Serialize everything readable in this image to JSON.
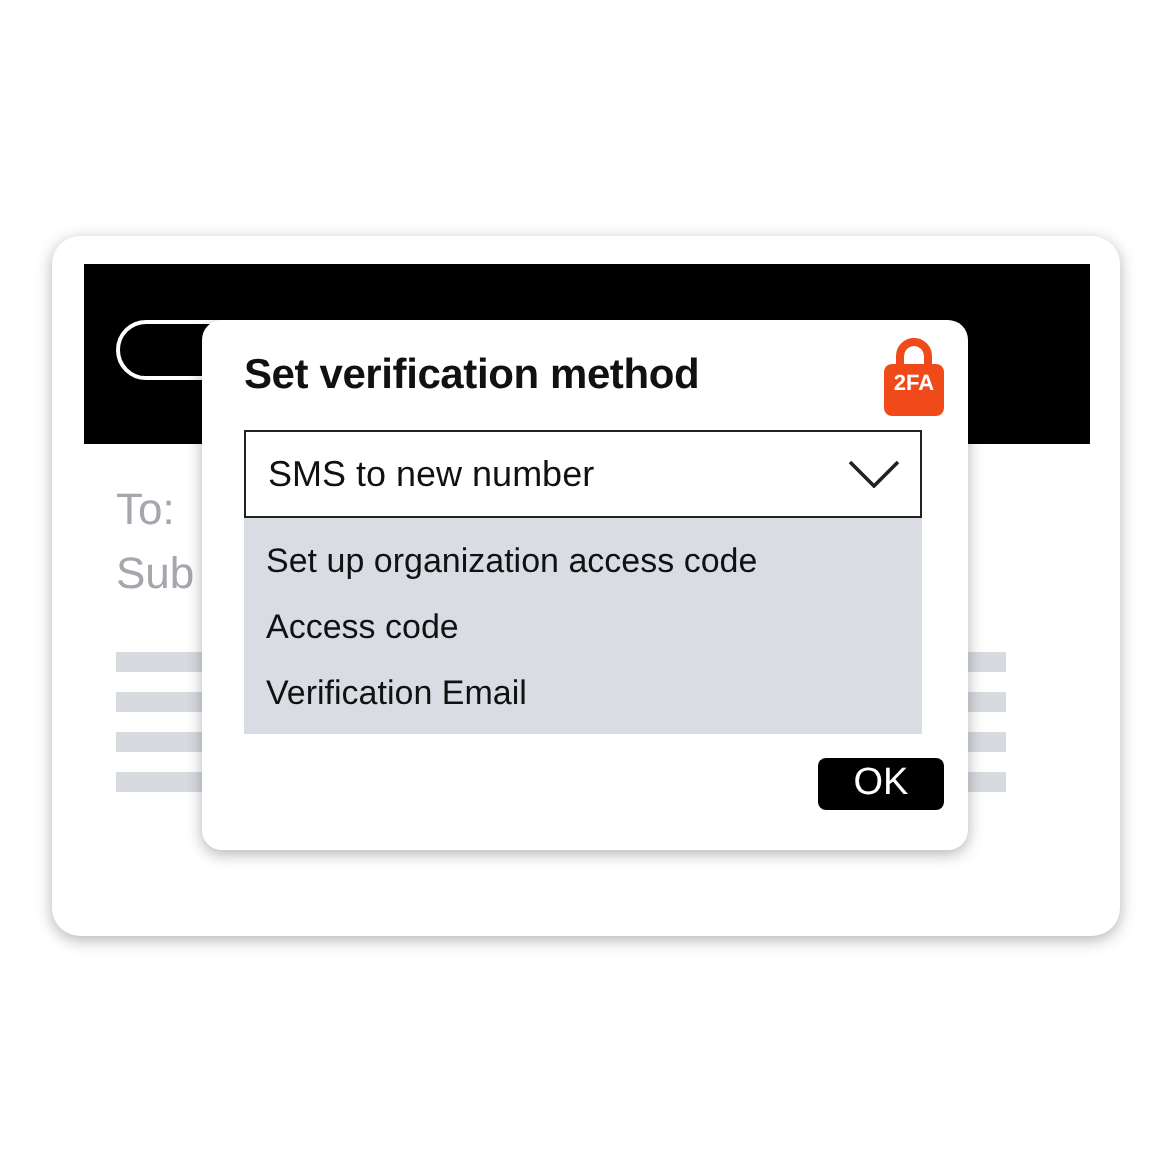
{
  "email": {
    "to_label": "To:",
    "subject_label": "Sub"
  },
  "dialog": {
    "title": "Set verification method",
    "badge": "2FA",
    "select": {
      "value": "SMS to new number"
    },
    "options": [
      {
        "label": "Set up organization access code"
      },
      {
        "label": "Access code"
      },
      {
        "label": "Verification Email"
      }
    ],
    "buttons": [
      "OK"
    ]
  }
}
